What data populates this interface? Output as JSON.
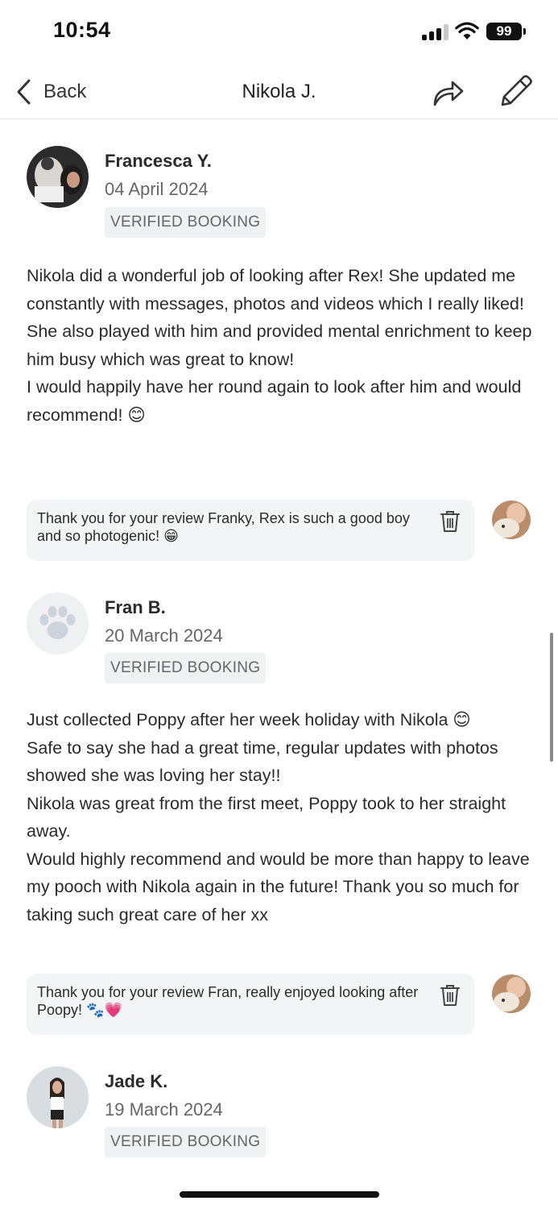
{
  "status_bar": {
    "time": "10:54",
    "battery": "99"
  },
  "nav": {
    "back_label": "Back",
    "title": "Nikola J."
  },
  "reviews": [
    {
      "name": "Francesca Y.",
      "date": "04 April 2024",
      "badge": "VERIFIED BOOKING",
      "body": [
        "Nikola did a wonderful job of looking after Rex! She updated me constantly with messages, photos and videos which I really liked!",
        "She also played with him and provided mental enrichment to keep him busy which was great to know!",
        "I would happily have her round again to look after him and would recommend! 😊"
      ],
      "reply": "Thank you for your review Franky, Rex is such a good boy and so photogenic! 😁"
    },
    {
      "name": "Fran B.",
      "date": "20 March 2024",
      "badge": "VERIFIED BOOKING",
      "body": [
        "Just collected Poppy after her week holiday with Nikola 😊",
        "Safe to say she had a great time, regular updates with photos showed she was loving her stay!!",
        "Nikola was great from the first meet, Poppy took to her straight away.",
        "Would highly recommend and would be more than happy to leave my pooch with Nikola again in the future! Thank you so much for taking such great care of her xx"
      ],
      "reply": "Thank you for your review Fran, really enjoyed looking after Poopy! 🐾💗"
    },
    {
      "name": "Jade K.",
      "date": "19 March 2024",
      "badge": "VERIFIED BOOKING"
    }
  ],
  "icons": {
    "back": "chevron-left-icon",
    "share": "share-arrow-icon",
    "edit": "pencil-icon",
    "delete": "trash-icon",
    "placeholder_avatar": "paw-icon"
  },
  "colors": {
    "badge_bg": "#f0f1f3",
    "reply_bg": "#f3f4f6",
    "text_muted": "#666666"
  }
}
